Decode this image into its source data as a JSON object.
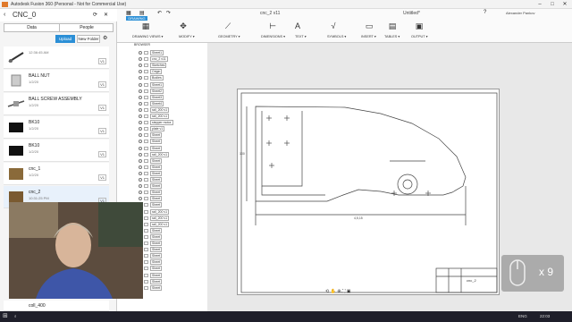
{
  "window": {
    "title": "Autodesk Fusion 360 (Personal - Not for Commercial Use)"
  },
  "data_panel": {
    "project": "CNC_0",
    "tabs": [
      "Data",
      "People"
    ],
    "upload_label": "Upload",
    "new_folder_label": "New Folder",
    "items": [
      {
        "name": "",
        "date": "12:36:45 AM",
        "version": "V1"
      },
      {
        "name": "BALL NUT",
        "date": "1/2/20",
        "version": "V1"
      },
      {
        "name": "BALL SCREW ASSEMBLY",
        "date": "1/2/20",
        "version": "V1"
      },
      {
        "name": "BK10",
        "date": "1/2/20",
        "version": "V1"
      },
      {
        "name": "BK10",
        "date": "1/2/20",
        "version": "V1"
      },
      {
        "name": "cnc_1",
        "date": "1/2/20",
        "version": "V1"
      },
      {
        "name": "cnc_2",
        "date": "10:31:25 PM",
        "version": "V1"
      },
      {
        "name": "coll_400",
        "date": "",
        "version": ""
      }
    ]
  },
  "toolbar": {
    "tabs": [
      "cnc_2 v11",
      "Untitled*"
    ],
    "user": "Alexander Pankov",
    "drawing_tab": "DRAWING",
    "groups": [
      {
        "label": "DRAWING VIEWS ▾",
        "icon": "▦"
      },
      {
        "label": "MODIFY ▾",
        "icon": "✥"
      },
      {
        "label": "GEOMETRY ▾",
        "icon": "⟋"
      },
      {
        "label": "DIMENSIONS ▾",
        "icon": "⊢"
      },
      {
        "label": "TEXT ▾",
        "icon": "A"
      },
      {
        "label": "SYMBOLS ▾",
        "icon": "√"
      },
      {
        "label": "INSERT ▾",
        "icon": "▭"
      },
      {
        "label": "TABLES ▾",
        "icon": "▤"
      },
      {
        "label": "OUTPUT ▾",
        "icon": "▣"
      }
    ]
  },
  "browser": {
    "header": "BROWSER",
    "rows": [
      "Sheet1",
      "cnc_2 v11 ",
      "Sketches",
      "Origin",
      "Bodies",
      "Sheet1",
      "Sheet2",
      "Sheet3",
      "Sheet4",
      "rail_200 v1",
      "rail_200 v1",
      "stepper motor",
      "plate v1",
      "Sheet",
      "Sheet",
      "Sheet",
      "rail_200 v1",
      "Sheet",
      "Sheet",
      "Sheet",
      "Sheet",
      "Sheet",
      "Sheet",
      "Sheet",
      "Sheet",
      "rail_200 v1",
      "rail_200 v1",
      "rail_200 v1",
      "Sheet",
      "Sheet",
      "Sheet",
      "Sheet",
      "Sheet",
      "Sheet",
      "Sheet",
      "Sheet",
      "Sheet",
      "Sheet"
    ]
  },
  "drawing": {
    "dim_bottom": "4,5,15",
    "dim_left": "100",
    "title_block_name": "cnc_2"
  },
  "overlay": {
    "count": "x 9"
  },
  "taskbar": {
    "lang": "ENG",
    "time": "22:03"
  },
  "colors": {
    "accent": "#2b8fd6",
    "drawing_line": "#444444"
  }
}
